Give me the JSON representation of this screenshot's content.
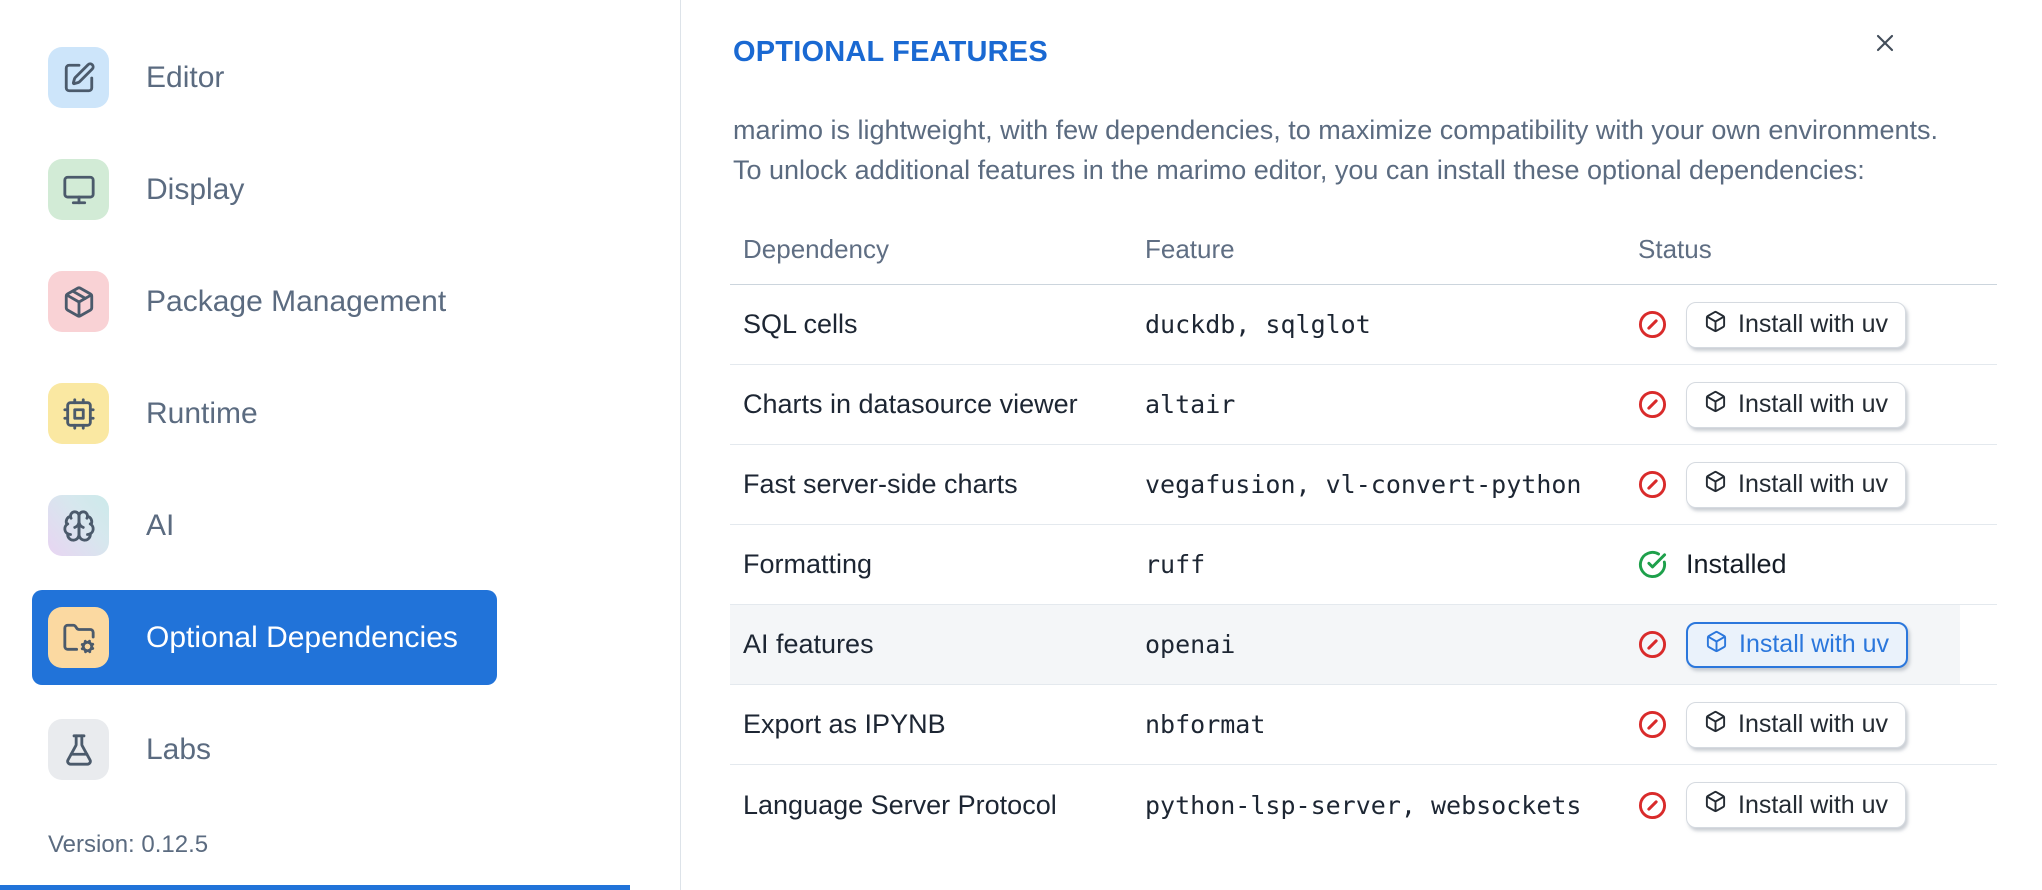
{
  "sidebar": {
    "items": [
      {
        "label": "Editor",
        "icon": "square-pen-icon",
        "icon_bg": "#cde5fa",
        "selected": false
      },
      {
        "label": "Display",
        "icon": "monitor-icon",
        "icon_bg": "#d2ebd6",
        "selected": false
      },
      {
        "label": "Package Management",
        "icon": "package-icon",
        "icon_bg": "#f9d2d5",
        "selected": false
      },
      {
        "label": "Runtime",
        "icon": "cpu-icon",
        "icon_bg": "#fae8a2",
        "selected": false
      },
      {
        "label": "AI",
        "icon": "brain-icon",
        "icon_bg": "linear-gradient(50deg, #e8d5f2 0%, #d7e7ee 60%, #cceaea 100%)",
        "selected": false
      },
      {
        "label": "Optional Dependencies",
        "icon": "folder-cog-icon",
        "icon_bg": "#fbd9a1",
        "selected": true
      },
      {
        "label": "Labs",
        "icon": "flask-icon",
        "icon_bg": "#e9ebee",
        "selected": false
      }
    ],
    "selected_color": "#2173d9",
    "version_label": "Version: 0.12.5"
  },
  "panel": {
    "title": "OPTIONAL FEATURES",
    "title_color": "#1a69d2",
    "description_line1": "marimo is lightweight, with few dependencies, to maximize compatibility with your own environments.",
    "description_line2": "To unlock additional features in the marimo editor, you can install these optional dependencies:"
  },
  "table": {
    "headers": {
      "dependency": "Dependency",
      "feature": "Feature",
      "status": "Status"
    },
    "install_button_label": "Install with uv",
    "installed_label": "Installed",
    "status_colors": {
      "not_installed": "#d92b2b",
      "installed": "#1ea04b"
    },
    "rows": [
      {
        "dependency": "SQL cells",
        "feature": "duckdb, sqlglot",
        "installed": false,
        "highlighted": false
      },
      {
        "dependency": "Charts in datasource viewer",
        "feature": "altair",
        "installed": false,
        "highlighted": false
      },
      {
        "dependency": "Fast server-side charts",
        "feature": "vegafusion, vl-convert-python",
        "installed": false,
        "highlighted": false
      },
      {
        "dependency": "Formatting",
        "feature": "ruff",
        "installed": true,
        "highlighted": false
      },
      {
        "dependency": "AI features",
        "feature": "openai",
        "installed": false,
        "highlighted": true
      },
      {
        "dependency": "Export as IPYNB",
        "feature": "nbformat",
        "installed": false,
        "highlighted": false
      },
      {
        "dependency": "Language Server Protocol",
        "feature": "python-lsp-server, websockets",
        "installed": false,
        "highlighted": false
      }
    ]
  }
}
